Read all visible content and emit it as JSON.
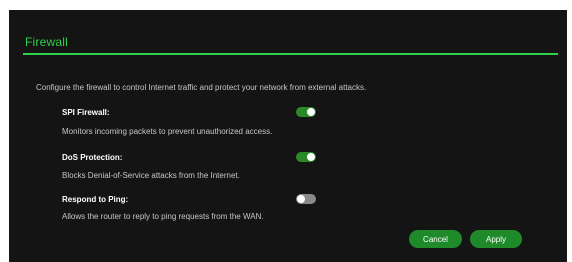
{
  "firewall": {
    "title": "Firewall",
    "description": "Configure the firewall to control Internet traffic and protect your network from external attacks."
  },
  "settings": [
    {
      "label": "SPI Firewall:",
      "help": "Monitors incoming packets to prevent unauthorized access.",
      "enabled": true
    },
    {
      "label": "DoS Protection:",
      "help": "Blocks Denial-of-Service attacks from the Internet.",
      "enabled": true
    },
    {
      "label": "Respond to Ping:",
      "help": "Allows the router to reply to ping requests from the WAN.",
      "enabled": false
    }
  ],
  "actions": {
    "cancel_label": "Cancel",
    "apply_label": "Apply"
  },
  "colors": {
    "accent": "#2fd04b",
    "toggle_on": "#2a8a2a",
    "toggle_off": "#8a8a8a",
    "button": "#1f8a2a",
    "background": "#141414"
  }
}
